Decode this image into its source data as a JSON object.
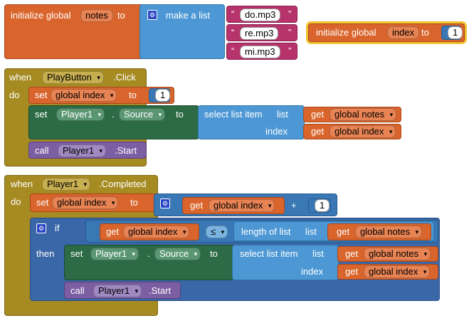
{
  "global_notes": {
    "initialize": "initialize global",
    "var": "notes",
    "to": "to",
    "make_a_list": "make a list",
    "items": [
      "do.mp3",
      "re.mp3",
      "mi.mp3"
    ]
  },
  "global_index": {
    "initialize": "initialize global",
    "var": "index",
    "to": "to",
    "value": "1"
  },
  "event_click": {
    "when": "when",
    "component": "PlayButton",
    "event": ".Click",
    "do": "do",
    "set": "set",
    "set_var": "global index",
    "to": "to",
    "set_value": "1",
    "set_comp_prop": {
      "set": "set",
      "component": "Player1",
      "dot": ".",
      "property": "Source",
      "to": "to",
      "select_list_item": "select list item",
      "list_label": "list",
      "get": "get",
      "list_var": "global notes",
      "index_label": "index",
      "index_var": "global index"
    },
    "call": "call",
    "call_component": "Player1",
    "call_method": ".Start"
  },
  "event_completed": {
    "when": "when",
    "component": "Player1",
    "event": ".Completed",
    "do": "do",
    "set": "set",
    "set_var": "global index",
    "to": "to",
    "get": "get",
    "get_var": "global index",
    "plus": "+",
    "plus_value": "1",
    "if": "if",
    "if_get": "get",
    "if_var": "global index",
    "compare_op": "≤",
    "length_of_list": "length of list",
    "list_label": "list",
    "len_get": "get",
    "len_var": "global notes",
    "then": "then",
    "set_comp_prop": {
      "set": "set",
      "component": "Player1",
      "dot": ".",
      "property": "Source",
      "to": "to",
      "select_list_item": "select list item",
      "list_label": "list",
      "get": "get",
      "list_var": "global notes",
      "index_label": "index",
      "index_var": "global index"
    },
    "call": "call",
    "call_component": "Player1",
    "call_method": ".Start"
  },
  "icons": {
    "dropdown": "▾",
    "mutator": "⚙",
    "quote_open": "“",
    "quote_close": "”"
  },
  "colors": {
    "variables": "#d9652c",
    "events": "#a68b22",
    "component_setters": "#2c6b45",
    "component_methods": "#7c5ea3",
    "lists": "#4d98d4",
    "text": "#b7336b",
    "math": "#3a78b5",
    "control": "#3a67a8"
  }
}
